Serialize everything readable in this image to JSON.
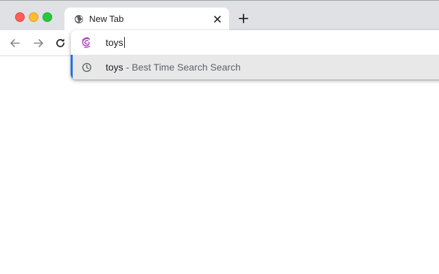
{
  "tab": {
    "title": "New Tab"
  },
  "omnibox": {
    "input_value": "toys",
    "suggestion": {
      "query": "toys",
      "separator": " - ",
      "description": "Best Time Search Search"
    }
  },
  "colors": {
    "accent": "#1a73e8",
    "engine_icon": "#a93cc4",
    "highlight_row": "#e8e8e9"
  }
}
